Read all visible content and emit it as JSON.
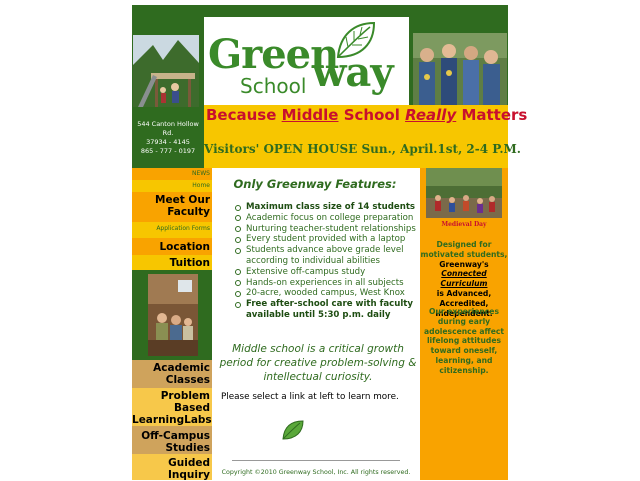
{
  "header": {
    "address_lines": [
      "544 Canton Hollow Rd.",
      "37934 - 4145",
      "865 - 777 - 0197"
    ],
    "logo_text_1": "Green",
    "logo_text_2": "School",
    "logo_text_3": "way",
    "tagline_because": "Because ",
    "tagline_middle": "Middle",
    "tagline_school": " School ",
    "tagline_really": "Really",
    "tagline_matters": " Matters",
    "open_house": "Visitors' OPEN HOUSE Sun., April.1st, 2-4 P.M."
  },
  "nav": {
    "news": "NEWS",
    "home": "Home",
    "meet_faculty_1": "Meet Our",
    "meet_faculty_2": "Faculty",
    "application_forms": "Application Forms",
    "location": "Location",
    "tuition": "Tuition",
    "academic_1": "Academic",
    "academic_2": "Classes",
    "problem_1": "Problem",
    "problem_2": "Based",
    "problem_3": "LearningLabs",
    "offcampus_1": "Off-Campus",
    "offcampus_2": "Studies",
    "guided_1": "Guided",
    "guided_2": "Inquiry"
  },
  "main": {
    "title": "Only Greenway Features:",
    "features": [
      "Maximum class size of 14 students",
      "Academic focus on college preparation",
      "Nurturing teacher-student relationships",
      "Every student provided with a laptop",
      "Students advance above grade level according to individual abilities",
      "Extensive off-campus study",
      "Hands-on experiences in all subjects",
      "20-acre, wooded campus, West Knox",
      "Free after-school care with faculty available until 5:30 p.m. daily"
    ],
    "quote": "Middle school is a critical growth period for creative problem-solving & intellectual curiosity.",
    "please": "Please select a link at left to learn more.",
    "copyright": "Copyright ©2010 Greenway School, Inc. All rights reserved."
  },
  "right": {
    "photo_caption": "Medieval Day",
    "designed_1": "Designed  for",
    "designed_2": "motivated students,",
    "designed_3": "Greenway's",
    "connected": "Connected Curriculum",
    "designed_4": "is  Advanced,",
    "designed_5": "Accredited, Independent.",
    "experiences": "Our experiences during early adolescence affect lifelong attitudes toward oneself, learning, and citizenship."
  },
  "colors": {
    "green": "#2f6b1f",
    "yellow": "#f7c600",
    "orange": "#f9a300",
    "red": "#c8102e",
    "tan": "#cfa35c"
  },
  "icons": {
    "logo_leaf": "leaf-icon",
    "footer_leaf": "leaf-icon"
  }
}
